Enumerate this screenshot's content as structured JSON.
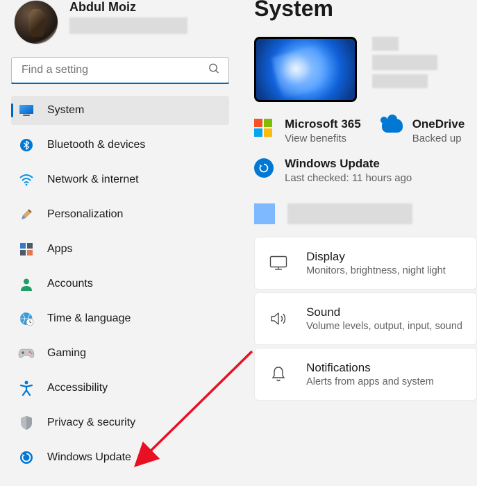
{
  "user": {
    "name": "Abdul Moiz"
  },
  "search": {
    "placeholder": "Find a setting"
  },
  "nav": [
    {
      "key": "system",
      "label": "System",
      "active": true
    },
    {
      "key": "bluetooth",
      "label": "Bluetooth & devices"
    },
    {
      "key": "network",
      "label": "Network & internet"
    },
    {
      "key": "personalization",
      "label": "Personalization"
    },
    {
      "key": "apps",
      "label": "Apps"
    },
    {
      "key": "accounts",
      "label": "Accounts"
    },
    {
      "key": "time",
      "label": "Time & language"
    },
    {
      "key": "gaming",
      "label": "Gaming"
    },
    {
      "key": "accessibility",
      "label": "Accessibility"
    },
    {
      "key": "privacy",
      "label": "Privacy & security"
    },
    {
      "key": "update",
      "label": "Windows Update"
    }
  ],
  "page": {
    "title": "System"
  },
  "status": {
    "ms365": {
      "title": "Microsoft 365",
      "sub": "View benefits"
    },
    "onedrive": {
      "title": "OneDrive",
      "sub": "Backed up"
    },
    "update": {
      "title": "Windows Update",
      "sub": "Last checked: 11 hours ago"
    }
  },
  "settings": [
    {
      "key": "display",
      "title": "Display",
      "sub": "Monitors, brightness, night light"
    },
    {
      "key": "sound",
      "title": "Sound",
      "sub": "Volume levels, output, input, sound"
    },
    {
      "key": "notifications",
      "title": "Notifications",
      "sub": "Alerts from apps and system"
    }
  ]
}
